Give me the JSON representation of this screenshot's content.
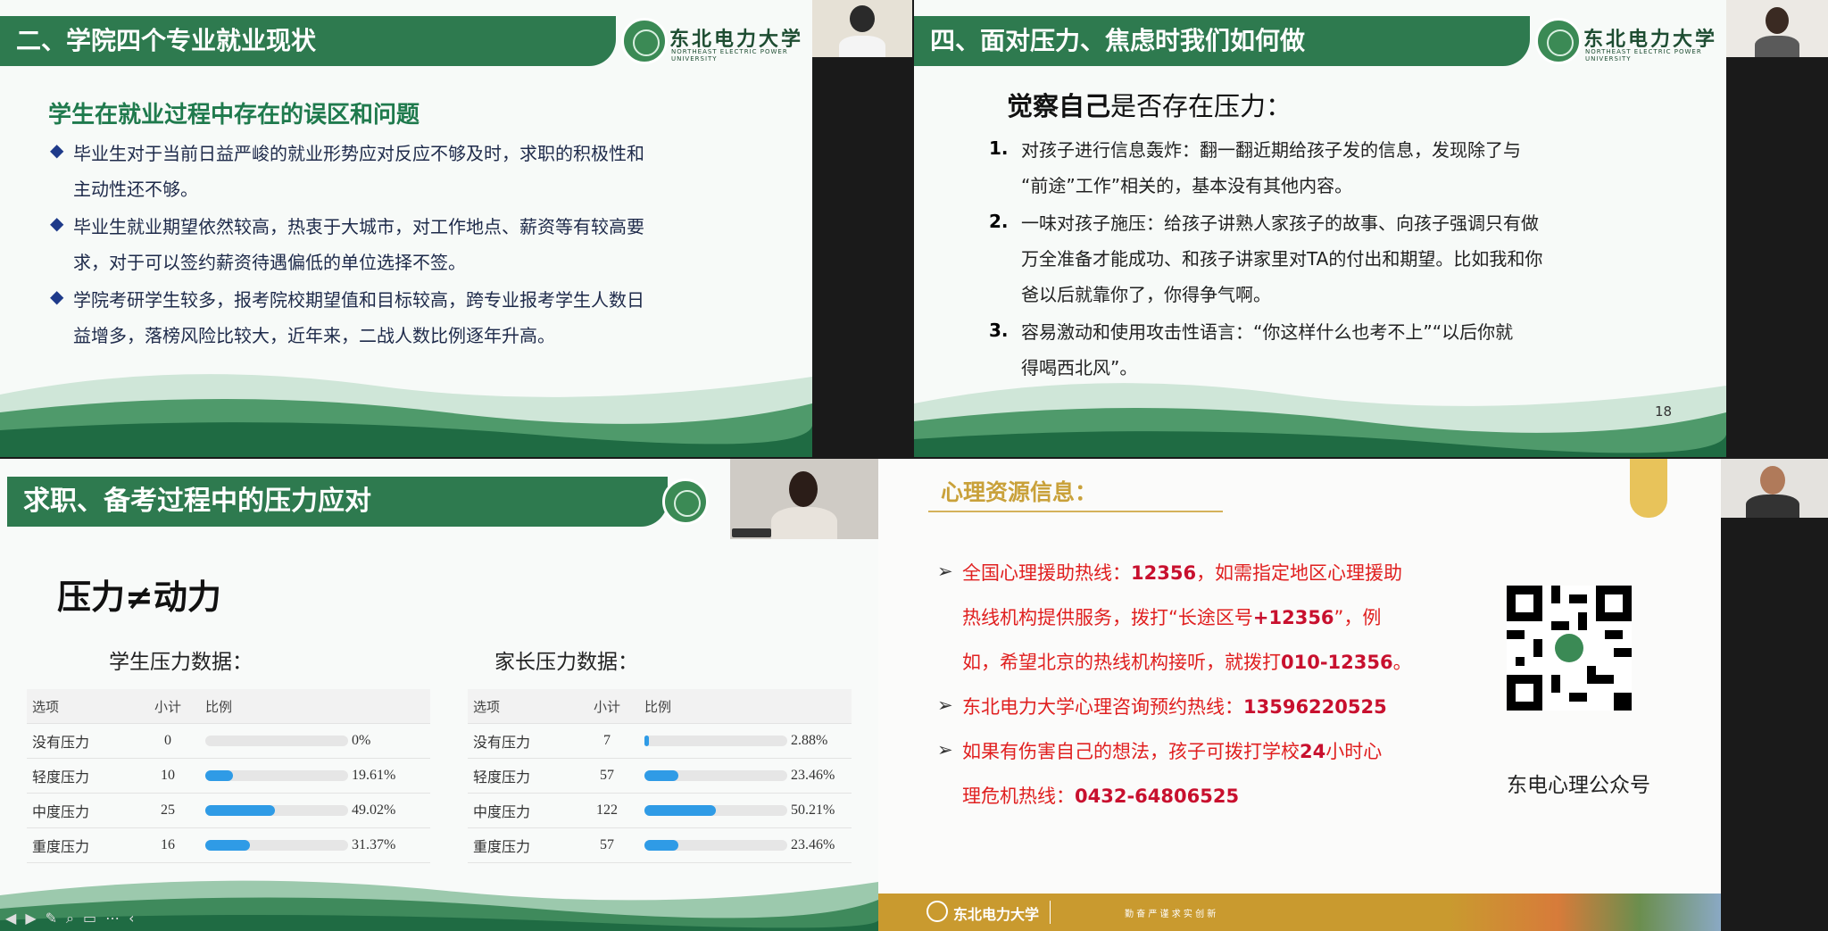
{
  "panels": {
    "top_left": {
      "header": "二、学院四个专业就业现状",
      "logo_text": "东北电力大学",
      "logo_sub": "NORTHEAST ELECTRIC POWER UNIVERSITY",
      "subtitle": "学生在就业过程中存在的误区和问题",
      "bullets": [
        {
          "l1": "毕业生对于当前日益严峻的就业形势应对反应不够及时，求职的积极性和",
          "l2": "主动性还不够。"
        },
        {
          "l1": "毕业生就业期望依然较高，热衷于大城市，对工作地点、薪资等有较高要",
          "l2": "求，对于可以签约薪资待遇偏低的单位选择不签。"
        },
        {
          "l1": "学院考研学生较多，报考院校期望值和目标较高，跨专业报考学生人数日",
          "l2": "益增多，落榜风险比较大，近年来，二战人数比例逐年升高。"
        }
      ]
    },
    "top_right": {
      "header": "四、面对压力、焦虑时我们如何做",
      "logo_text": "东北电力大学",
      "logo_sub": "NORTHEAST ELECTRIC POWER UNIVERSITY",
      "title_bold": "觉察自己",
      "title_rest": "是否存在压力：",
      "items": [
        {
          "num": "1.",
          "l1": "对孩子进行信息轰炸：翻一翻近期给孩子发的信息，发现除了与",
          "l2": "“前途”工作”相关的，基本没有其他内容。"
        },
        {
          "num": "2.",
          "l1": "一味对孩子施压：给孩子讲熟人家孩子的故事、向孩子强调只有做",
          "l2": "万全准备才能成功、和孩子讲家里对TA的付出和期望。比如我和你",
          "l3": "爸以后就靠你了，你得争气啊。"
        },
        {
          "num": "3.",
          "l1": "容易激动和使用攻击性语言：“你这样什么也考不上”“以后你就",
          "l2": "得喝西北风”。"
        }
      ],
      "page_num": "18"
    },
    "bottom_left": {
      "header": "求职、备考过程中的压力应对",
      "big_title": "压力≠动力",
      "student_label": "学生压力数据：",
      "parent_label": "家长压力数据：",
      "columns": [
        "选项",
        "小计",
        "比例"
      ],
      "student_rows": [
        {
          "option": "没有压力",
          "count": "0",
          "pct": "0%",
          "ratio": 0
        },
        {
          "option": "轻度压力",
          "count": "10",
          "pct": "19.61%",
          "ratio": 0.1961
        },
        {
          "option": "中度压力",
          "count": "25",
          "pct": "49.02%",
          "ratio": 0.4902
        },
        {
          "option": "重度压力",
          "count": "16",
          "pct": "31.37%",
          "ratio": 0.3137
        }
      ],
      "parent_rows": [
        {
          "option": "没有压力",
          "count": "7",
          "pct": "2.88%",
          "ratio": 0.0288
        },
        {
          "option": "轻度压力",
          "count": "57",
          "pct": "23.46%",
          "ratio": 0.2346
        },
        {
          "option": "中度压力",
          "count": "122",
          "pct": "50.21%",
          "ratio": 0.5021
        },
        {
          "option": "重度压力",
          "count": "57",
          "pct": "23.46%",
          "ratio": 0.2346
        }
      ]
    },
    "bottom_right": {
      "title": "心理资源信息：",
      "line1a": "全国心理援助热线：",
      "line1b": "12356",
      "line1c": "，如需指定地区心理援助",
      "line2a": "热线机构提供服务，拨打“长途区号",
      "line2b": "+12356",
      "line2c": "”，例",
      "line3a": "如，希望北京的热线机构接听，就拨打",
      "line3b": "010-12356",
      "line3c": "。",
      "line4a": "东北电力大学心理咨询预约热线：",
      "line4b": "13596220525",
      "line5a": "如果有伤害自己的想法，孩子可拨打学校",
      "line5b": "24",
      "line5c": "小时心",
      "line6a": "理危机热线：",
      "line6b": "0432-64806525",
      "qr_caption": "东电心理公众号",
      "footer_logo": "东北电力大学",
      "footer_slogan": "勤 奋 严 谨 求 实 创 新"
    }
  },
  "colors": {
    "header_green": "#2e7a4f",
    "title_green": "#1f7a4d",
    "bar_blue": "#2f9be6",
    "red_text": "#e02020",
    "gold": "#c9a13a"
  }
}
